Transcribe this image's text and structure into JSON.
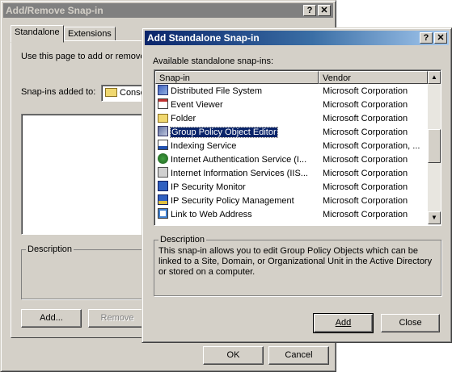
{
  "back_window": {
    "title": "Add/Remove Snap-in",
    "help_btn": "?",
    "close_btn": "✕",
    "tabs": [
      {
        "label": "Standalone"
      },
      {
        "label": "Extensions"
      }
    ],
    "intro_text": "Use this page to add or remove",
    "snapins_added_label": "Snap-ins added to:",
    "snapins_added_value": "Conso",
    "description_label": "Description",
    "add_label": "Add...",
    "remove_label": "Remove",
    "ok_label": "OK",
    "cancel_label": "Cancel"
  },
  "front_window": {
    "title": "Add Standalone Snap-in",
    "help_btn": "?",
    "close_btn": "✕",
    "available_label": "Available standalone snap-ins:",
    "columns": [
      "Snap-in",
      "Vendor"
    ],
    "rows": [
      {
        "name": "Distributed File System",
        "vendor": "Microsoft Corporation",
        "icon": "dfs-icon"
      },
      {
        "name": "Event Viewer",
        "vendor": "Microsoft Corporation",
        "icon": "event-viewer-icon"
      },
      {
        "name": "Folder",
        "vendor": "Microsoft Corporation",
        "icon": "folder-icon"
      },
      {
        "name": "Group Policy Object Editor",
        "vendor": "Microsoft Corporation",
        "icon": "group-policy-icon",
        "selected": true
      },
      {
        "name": "Indexing Service",
        "vendor": "Microsoft Corporation, ...",
        "icon": "indexing-icon"
      },
      {
        "name": "Internet Authentication Service (I...",
        "vendor": "Microsoft Corporation",
        "icon": "ias-icon"
      },
      {
        "name": "Internet Information Services (IIS...",
        "vendor": "Microsoft Corporation",
        "icon": "iis-icon"
      },
      {
        "name": "IP Security Monitor",
        "vendor": "Microsoft Corporation",
        "icon": "ipsec-monitor-icon"
      },
      {
        "name": "IP Security Policy Management",
        "vendor": "Microsoft Corporation",
        "icon": "ipsec-policy-icon"
      },
      {
        "name": "Link to Web Address",
        "vendor": "Microsoft Corporation",
        "icon": "web-link-icon"
      }
    ],
    "description_label": "Description",
    "description_text": "This snap-in allows you to edit Group Policy Objects which can be linked to a Site, Domain, or Organizational Unit in the Active Directory or stored on a computer.",
    "add_label": "Add",
    "close_label": "Close"
  }
}
